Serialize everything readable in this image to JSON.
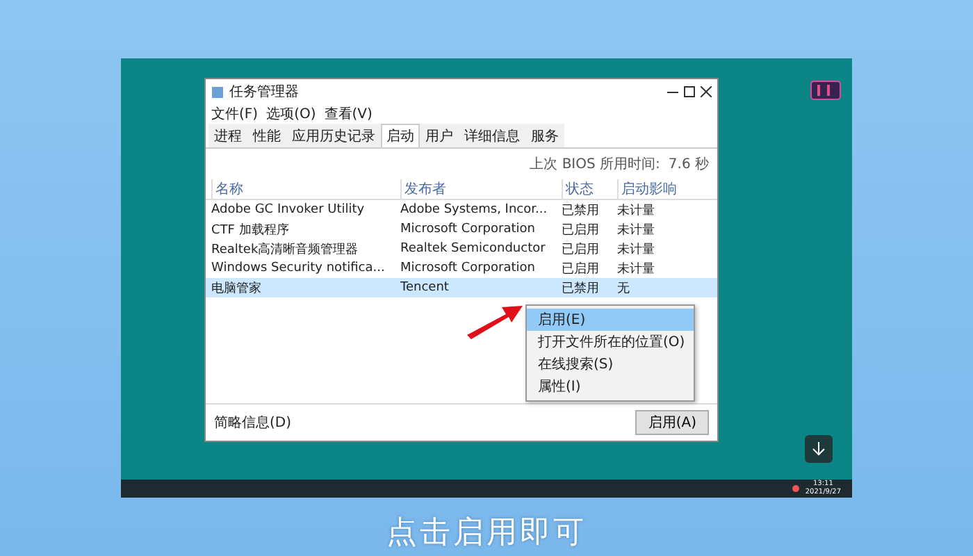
{
  "window": {
    "title": "任务管理器"
  },
  "menu": [
    "文件(F)",
    "选项(O)",
    "查看(V)"
  ],
  "tabs": [
    {
      "label": "进程",
      "selected": false
    },
    {
      "label": "性能",
      "selected": false
    },
    {
      "label": "应用历史记录",
      "selected": false
    },
    {
      "label": "启动",
      "selected": true
    },
    {
      "label": "用户",
      "selected": false
    },
    {
      "label": "详细信息",
      "selected": false
    },
    {
      "label": "服务",
      "selected": false
    }
  ],
  "bios_time": {
    "label": "上次 BIOS 所用时间:",
    "value": "7.6 秒"
  },
  "columns": [
    "名称",
    "发布者",
    "状态",
    "启动影响"
  ],
  "rows": [
    {
      "name": "Adobe GC Invoker Utility",
      "publisher": "Adobe Systems, Incor...",
      "status": "已禁用",
      "impact": "未计量",
      "selected": false
    },
    {
      "name": "CTF 加载程序",
      "publisher": "Microsoft Corporation",
      "status": "已启用",
      "impact": "未计量",
      "selected": false
    },
    {
      "name": "Realtek高清晰音频管理器",
      "publisher": "Realtek Semiconductor",
      "status": "已启用",
      "impact": "未计量",
      "selected": false
    },
    {
      "name": "Windows Security notifica...",
      "publisher": "Microsoft Corporation",
      "status": "已启用",
      "impact": "未计量",
      "selected": false
    },
    {
      "name": "电脑管家",
      "publisher": "Tencent",
      "status": "已禁用",
      "impact": "无",
      "selected": true
    }
  ],
  "context_menu": [
    {
      "label": "启用(E)",
      "selected": true
    },
    {
      "label": "打开文件所在的位置(O)",
      "selected": false
    },
    {
      "label": "在线搜索(S)",
      "selected": false
    },
    {
      "label": "属性(I)",
      "selected": false
    }
  ],
  "footer": {
    "details": "简略信息(D)",
    "button": "启用(A)"
  },
  "taskbar": {
    "time": "13:11",
    "date": "2021/9/27"
  },
  "caption": "点击启用即可"
}
